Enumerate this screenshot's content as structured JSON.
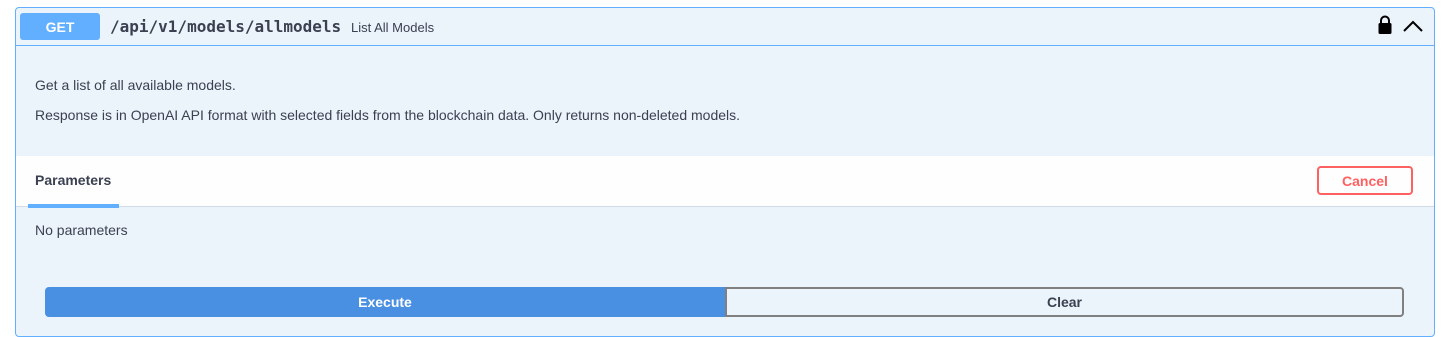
{
  "operation": {
    "method": "GET",
    "path": "/api/v1/models/allmodels",
    "summary": "List All Models",
    "lock_icon": "lock-icon",
    "collapse_icon": "chevron-up-icon"
  },
  "description": {
    "line1": "Get a list of all available models.",
    "line2": "Response is in OpenAI API format with selected fields from the blockchain data. Only returns non-deleted models."
  },
  "parameters": {
    "tab_label": "Parameters",
    "cancel_label": "Cancel",
    "empty_text": "No parameters"
  },
  "actions": {
    "execute_label": "Execute",
    "clear_label": "Clear"
  },
  "colors": {
    "get_method": "#61affe",
    "execute": "#4990e2",
    "cancel": "#ff6060",
    "background": "#ebf3fb"
  }
}
